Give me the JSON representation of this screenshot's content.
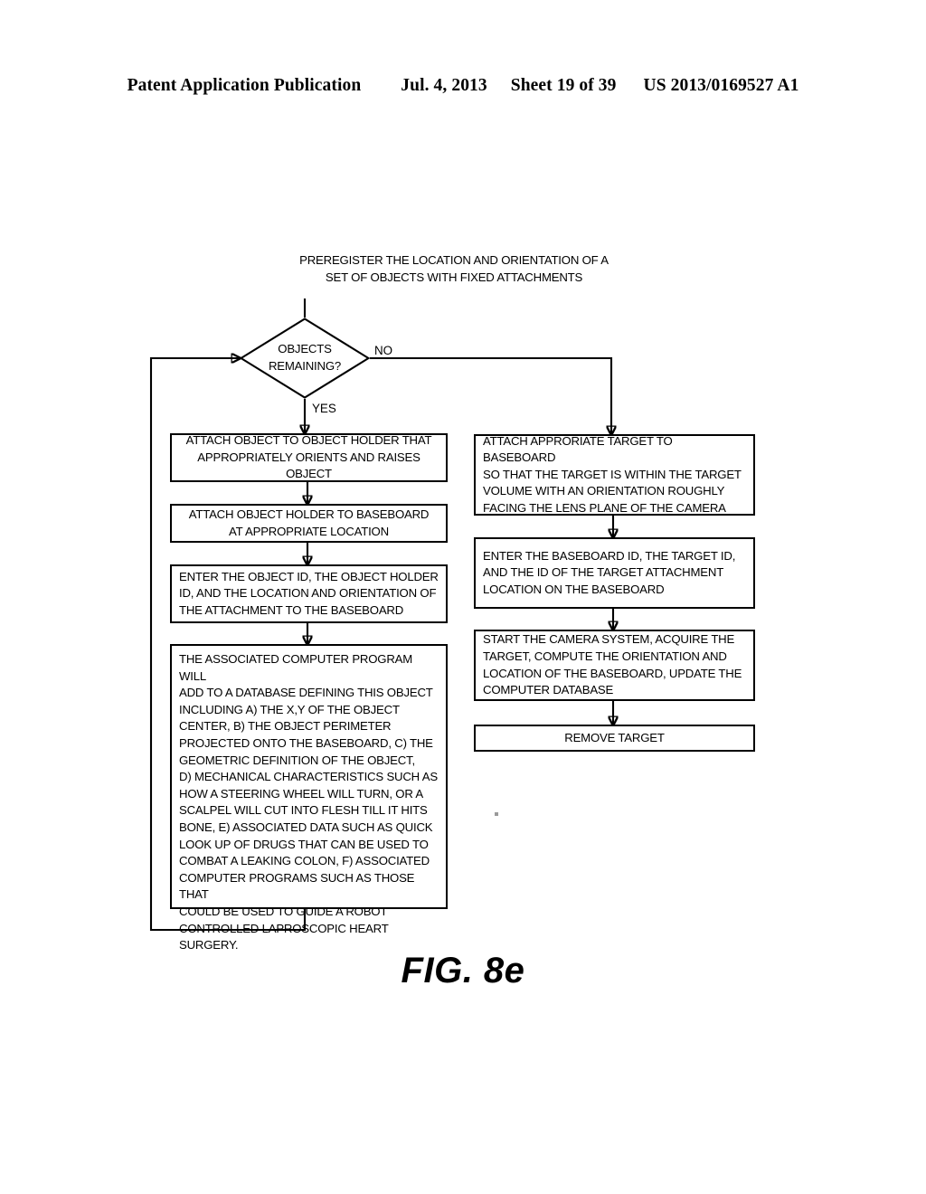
{
  "header": {
    "publication": "Patent Application Publication",
    "date": "Jul. 4, 2013",
    "sheet": "Sheet 19 of 39",
    "patent_number": "US 2013/0169527 A1"
  },
  "figure": {
    "caption": "FIG. 8e",
    "title": "PREREGISTER THE LOCATION AND ORIENTATION OF A\nSET OF OBJECTS WITH FIXED ATTACHMENTS"
  },
  "flowchart": {
    "decision": {
      "label": "OBJECTS\nREMAINING?",
      "branch_yes": "YES",
      "branch_no": "NO"
    },
    "left_branch": [
      {
        "id": "attach-object-to-holder",
        "text": "ATTACH OBJECT TO OBJECT HOLDER THAT\nAPPROPRIATELY ORIENTS AND RAISES OBJECT"
      },
      {
        "id": "attach-holder-to-baseboard",
        "text": "ATTACH OBJECT HOLDER TO BASEBOARD\nAT APPROPRIATE LOCATION"
      },
      {
        "id": "enter-object-id",
        "text": "ENTER THE OBJECT ID, THE OBJECT HOLDER\nID, AND THE LOCATION AND ORIENTATION OF\nTHE ATTACHMENT TO THE BASEBOARD"
      },
      {
        "id": "computer-program-database",
        "text": "THE ASSOCIATED COMPUTER PROGRAM WILL\nADD TO A DATABASE DEFINING THIS OBJECT\nINCLUDING A) THE X,Y OF THE OBJECT\nCENTER, B) THE OBJECT PERIMETER\nPROJECTED ONTO THE BASEBOARD, C)  THE\nGEOMETRIC DEFINITION OF THE OBJECT,\nD) MECHANICAL CHARACTERISTICS SUCH AS\nHOW A STEERING WHEEL WILL TURN, OR A\nSCALPEL WILL CUT INTO FLESH TILL IT HITS\nBONE, E) ASSOCIATED DATA SUCH AS QUICK\nLOOK UP OF DRUGS THAT CAN BE USED TO\nCOMBAT A LEAKING COLON, F) ASSOCIATED\nCOMPUTER PROGRAMS SUCH AS THOSE THAT\nCOULD BE USED TO GUIDE A ROBOT\nCONTROLLED LAPROSCOPIC HEART SURGERY."
      }
    ],
    "right_branch": [
      {
        "id": "attach-target-to-baseboard",
        "text": "ATTACH APPRORIATE TARGET TO BASEBOARD\nSO THAT THE TARGET IS WITHIN THE TARGET\nVOLUME WITH AN ORIENTATION ROUGHLY\nFACING THE LENS PLANE OF THE CAMERA"
      },
      {
        "id": "enter-baseboard-id",
        "text": "ENTER THE BASEBOARD ID, THE TARGET ID,\nAND THE ID OF THE TARGET ATTACHMENT\nLOCATION ON THE BASEBOARD"
      },
      {
        "id": "start-camera-system",
        "text": "START THE CAMERA SYSTEM, ACQUIRE THE\nTARGET, COMPUTE THE ORIENTATION AND\nLOCATION OF THE BASEBOARD, UPDATE THE\nCOMPUTER DATABASE"
      },
      {
        "id": "remove-target",
        "text": "REMOVE TARGET"
      }
    ]
  }
}
